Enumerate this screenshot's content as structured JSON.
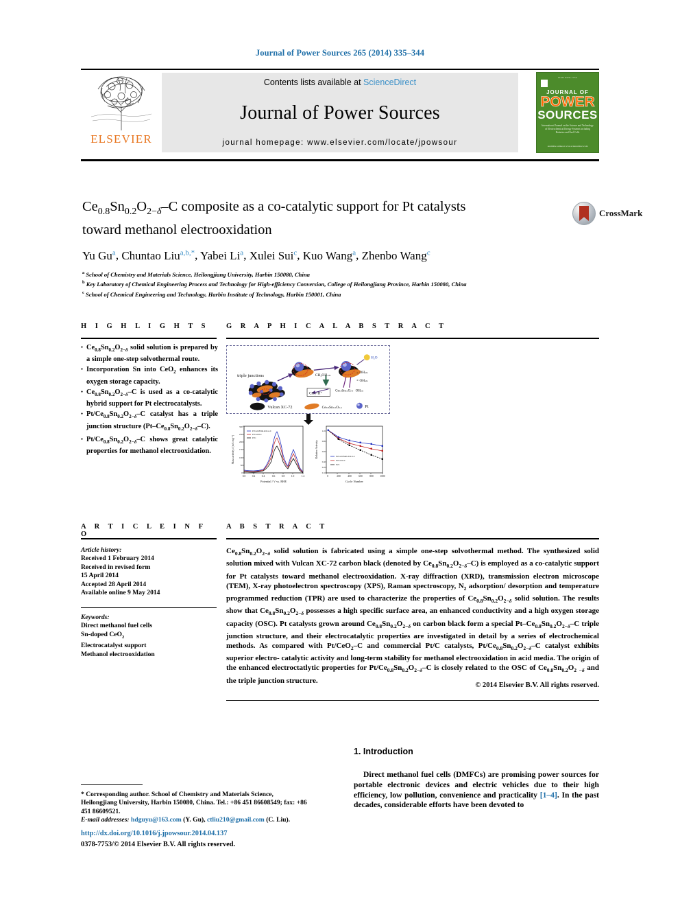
{
  "running_head": "Journal of Power Sources 265 (2014) 335–344",
  "masthead": {
    "contents_prefix": "Contents lists available at ",
    "sciencedirect": "ScienceDirect",
    "journal_title": "Journal of Power Sources",
    "homepage": "journal homepage: www.elsevier.com/locate/jpowsour",
    "publisher": "ELSEVIER",
    "cover": {
      "issn_top": "ISSN 0378-7753",
      "journal_of": "JOURNAL OF",
      "power": "POWER",
      "sources": "SOURCES",
      "subtitle": "International Journal on the Science and Technology of Electrochemical Energy Systems including Batteries and Fuel Cells",
      "footer": "Available online at www.sciencedirect.com"
    }
  },
  "article": {
    "title_line1": "Ce0.8Sn0.2O2−δ–C composite as a co-catalytic support for Pt catalysts",
    "title_line2": "toward methanol electrooxidation",
    "crossmark_label": "CrossMark",
    "authors": [
      {
        "name": "Yu Gu",
        "sup": "a"
      },
      {
        "name": "Chuntao Liu",
        "sup": "a,b,*"
      },
      {
        "name": "Yabei Li",
        "sup": "a"
      },
      {
        "name": "Xulei Sui",
        "sup": "c"
      },
      {
        "name": "Kuo Wang",
        "sup": "a"
      },
      {
        "name": "Zhenbo Wang",
        "sup": "c"
      }
    ],
    "affiliations": [
      {
        "sup": "a",
        "text": "School of Chemistry and Materials Science, Heilongjiang University, Harbin 150080, China"
      },
      {
        "sup": "b",
        "text": "Key Laboratory of Chemical Engineering Process and Technology for High-efficiency Conversion, College of Heilongjiang Province, Harbin 150080, China"
      },
      {
        "sup": "c",
        "text": "School of Chemical Engineering and Technology, Harbin Institute of Technology, Harbin 150001, China"
      }
    ]
  },
  "highlights": {
    "heading": "H I G H L I G H T S",
    "items": [
      "Ce0.8Sn0.2O2−δ solid solution is prepared by a simple one-step solvothermal route.",
      "Incorporation Sn into CeO2 enhances its oxygen storage capacity.",
      "Ce0.8Sn0.2O2−δ–C is used as a co-catalytic hybrid support for Pt electrocatalysts.",
      "Pt/Ce0.8Sn0.2O2−δ–C catalyst has a triple junction structure (Pt–Ce0.8Sn0.2O2−δ–C).",
      "Pt/Ce0.8Sn0.2O2−δ–C shows great catalytic properties for methanol electrooxidation."
    ]
  },
  "graphical_abstract": {
    "heading": "G R A P H I C A L   A B S T R A C T",
    "schematic": {
      "triple_junctions_label": "triple junctions",
      "arrow_label": "CH3OHads",
      "h2o_label": "H2O",
      "oh_labels": [
        "OHads",
        "OHads"
      ],
      "ce_sn_label": "Ce0.8Sn0.2O2−δ",
      "product_label": "CO2 + H+",
      "legend": [
        {
          "name": "Vulcan XC-72",
          "color": "#1a1a1a"
        },
        {
          "name": "Ce0.8Sn0.2O2−δ",
          "color": "#e07b26"
        },
        {
          "name": "Pt",
          "color": "#5a63c8"
        }
      ]
    }
  },
  "chart_data": [
    {
      "type": "line",
      "title": "",
      "xlabel": "Potential / V vs. RHE",
      "ylabel": "Mass activity / (mA mg−1)",
      "xlim": [
        0.0,
        1.2
      ],
      "xticks": [
        "0.0",
        "0.2",
        "0.4",
        "0.6",
        "0.8",
        "1.0",
        "1.2"
      ],
      "yticks": [
        "0",
        "50",
        "100",
        "150",
        "200",
        "250",
        "300"
      ],
      "ylim": [
        0,
        300
      ],
      "legend_position": "top-left",
      "series": [
        {
          "name": "Pt/Ce0.8Sn0.2O2−δ–C",
          "color": "#2030c0",
          "x": [
            0.0,
            0.1,
            0.2,
            0.3,
            0.4,
            0.5,
            0.6,
            0.65,
            0.7,
            0.75,
            0.8,
            0.85,
            0.9,
            1.0,
            1.1,
            1.2
          ],
          "values": [
            18,
            14,
            12,
            12,
            20,
            55,
            160,
            240,
            270,
            230,
            120,
            60,
            95,
            150,
            60,
            15
          ]
        },
        {
          "name": "Pt/CeO2–C",
          "color": "#c02020",
          "x": [
            0.0,
            0.1,
            0.2,
            0.3,
            0.4,
            0.5,
            0.6,
            0.65,
            0.7,
            0.75,
            0.8,
            0.85,
            0.9,
            1.0,
            1.1,
            1.2
          ],
          "values": [
            14,
            11,
            10,
            10,
            16,
            42,
            130,
            195,
            215,
            180,
            95,
            50,
            75,
            120,
            48,
            12
          ]
        },
        {
          "name": "Pt/C",
          "color": "#111111",
          "x": [
            0.0,
            0.1,
            0.2,
            0.3,
            0.4,
            0.5,
            0.6,
            0.65,
            0.7,
            0.75,
            0.8,
            0.85,
            0.9,
            1.0,
            1.1,
            1.2
          ],
          "values": [
            10,
            8,
            7,
            7,
            12,
            30,
            95,
            140,
            155,
            128,
            70,
            38,
            55,
            88,
            35,
            9
          ]
        }
      ]
    },
    {
      "type": "line",
      "title": "",
      "xlabel": "Cycle Number",
      "ylabel": "Relative Activity",
      "xlim": [
        0,
        1000
      ],
      "xticks": [
        "0",
        "200",
        "400",
        "600",
        "800",
        "1000"
      ],
      "ylim": [
        0.1,
        1.0
      ],
      "yticks": [
        "0.1",
        "0.2",
        "0.4",
        "0.6",
        "0.8",
        "1.0"
      ],
      "legend_position": "bottom-left",
      "series": [
        {
          "name": "Pt/Ce0.8Sn0.2O2−δ–C",
          "color": "#2030c0",
          "x": [
            0,
            200,
            400,
            600,
            800,
            1000
          ],
          "values": [
            1.0,
            0.88,
            0.82,
            0.79,
            0.76,
            0.73
          ]
        },
        {
          "name": "Pt/CeO2–C",
          "color": "#c02020",
          "x": [
            0,
            200,
            400,
            600,
            800,
            1000
          ],
          "values": [
            1.0,
            0.86,
            0.79,
            0.74,
            0.69,
            0.65
          ]
        },
        {
          "name": "Pt/C",
          "color": "#111111",
          "x": [
            0,
            200,
            400,
            600,
            800,
            1000
          ],
          "values": [
            1.0,
            0.85,
            0.75,
            0.66,
            0.57,
            0.5
          ]
        }
      ]
    }
  ],
  "article_info": {
    "heading": "A R T I C L E   I N F O",
    "history_label": "Article history:",
    "history": [
      "Received 1 February 2014",
      "Received in revised form",
      "15 April 2014",
      "Accepted 28 April 2014",
      "Available online 9 May 2014"
    ],
    "keywords_label": "Keywords:",
    "keywords": [
      "Direct methanol fuel cells",
      "Sn-doped CeO2",
      "Electrocatalyst support",
      "Methanol electrooxidation"
    ]
  },
  "abstract": {
    "heading": "A B S T R A C T",
    "text": "Ce0.8Sn0.2O2−δ solid solution is fabricated using a simple one-step solvothermal method. The synthesized solid solution mixed with Vulcan XC-72 carbon black (denoted by Ce0.8Sn0.2O2−δ–C) is employed as a co-catalytic support for Pt catalysts toward methanol electrooxidation. X-ray diffraction (XRD), transmission electron microscope (TEM), X-ray photoelectron spectroscopy (XPS), Raman spectroscopy, N2 adsorption/desorption and temperature programmed reduction (TPR) are used to characterize the properties of Ce0.8Sn0.2O2−δ solid solution. The results show that Ce0.8Sn0.2O2−δ possesses a high specific surface area, an enhanced conductivity and a high oxygen storage capacity (OSC). Pt catalysts grown around Ce0.8Sn0.2O2−δ on carbon black form a special Pt–Ce0.8Sn0.2O2−δ–C triple junction structure, and their electrocatalytic properties are investigated in detail by a series of electrochemical methods. As compared with Pt/CeO2–C and commercial Pt/C catalysts, Pt/Ce0.8Sn0.2O2−δ–C catalyst exhibits superior electrocatalytic activity and long-term stability for methanol electrooxidation in acid media. The origin of the enhanced electroctatlytic properties for Pt/Ce0.8Sn0.2O2−δ–C is closely related to the OSC of Ce0.8Sn0.2O2−δ and the triple junction structure.",
    "copyright": "© 2014 Elsevier B.V. All rights reserved."
  },
  "introduction": {
    "heading": "1.  Introduction",
    "paragraph": "Direct methanol fuel cells (DMFCs) are promising power sources for portable electronic devices and electric vehicles due to their high efficiency, low pollution, convenience and practicality ",
    "citation": "[1–4]",
    "paragraph_end": ". In the past decades, considerable efforts have been devoted to"
  },
  "footnotes": {
    "corresponding": "* Corresponding author. School of Chemistry and Materials Science, Heilongjiang University, Harbin 150080, China. Tel.: +86 451 86608549; fax: +86 451 86609521.",
    "email_label": "E-mail addresses:",
    "emails": [
      {
        "address": "hdguyu@163.com",
        "who": "(Y. Gu)"
      },
      {
        "address": "ctliu210@gmail.com",
        "who": "(C. Liu)"
      }
    ],
    "doi": "http://dx.doi.org/10.1016/j.jpowsour.2014.04.137",
    "issn_line": "0378-7753/© 2014 Elsevier B.V. All rights reserved."
  },
  "colors": {
    "link_blue": "#1f6fa8",
    "sciencedirect_blue": "#3a8fc7",
    "elsevier_orange": "#E87722",
    "cover_green": "#4c8b2b",
    "crossmark_red": "#b03020"
  }
}
